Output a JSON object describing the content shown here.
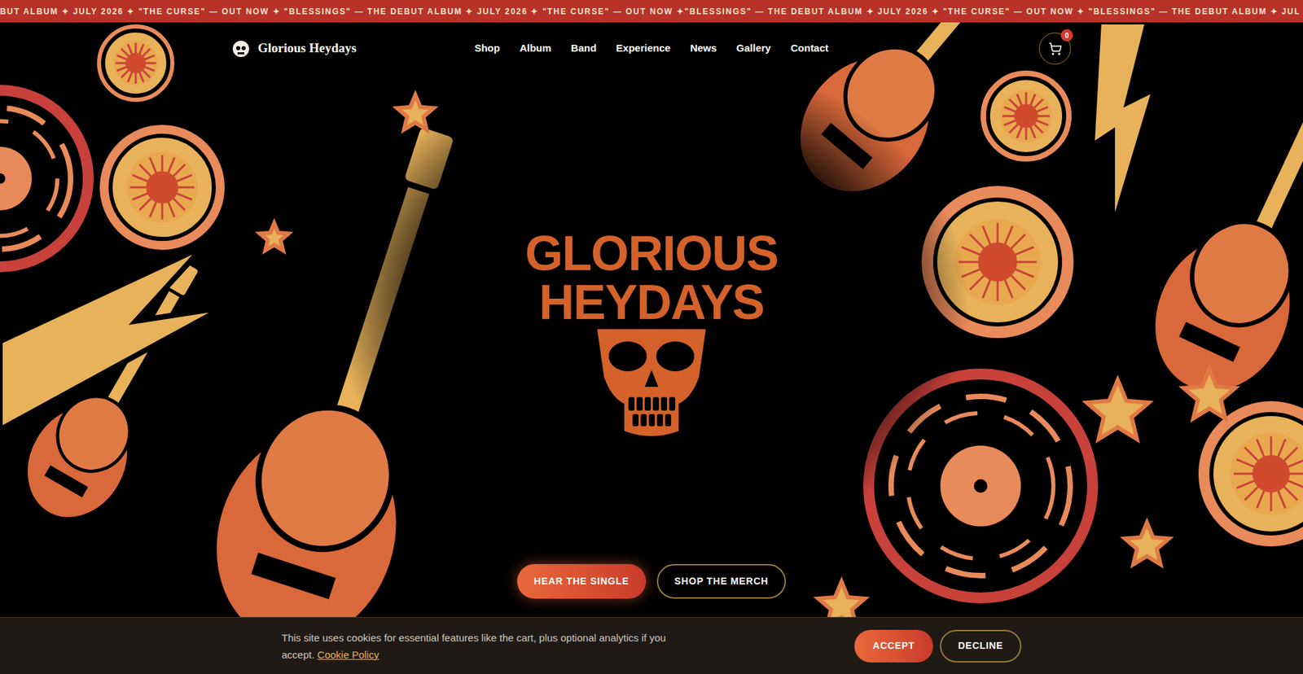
{
  "announcement_bar": {
    "text": "BUT ALBUM ✦ JULY 2026 ✦ \"THE CURSE\" — OUT NOW ✦ \"BLESSINGS\" — THE DEBUT ALBUM ✦ JULY 2026 ✦ \"THE CURSE\" — OUT NOW ✦\"BLESSINGS\" — THE DEBUT ALBUM ✦ JULY 2026 ✦ \"THE CURSE\" — OUT NOW ✦ \"BLESSINGS\" — THE DEBUT ALBUM ✦ JUL"
  },
  "nav": {
    "brand": "Glorious Heydays",
    "links": [
      "Shop",
      "Album",
      "Band",
      "Experience",
      "News",
      "Gallery",
      "Contact"
    ],
    "cart": {
      "count": "0"
    }
  },
  "hero": {
    "logo_lines": [
      "GLORIOUS",
      "HEYDAYS"
    ],
    "buttons": [
      "HEAR THE SINGLE",
      "SHOP THE MERCH"
    ]
  },
  "cookie_banner": {
    "text": "This site uses cookies for essential features like the cart, plus optional analytics if you accept.",
    "link": "Cookie Policy",
    "buttons": [
      "ACCEPT",
      "DECLINE"
    ]
  }
}
